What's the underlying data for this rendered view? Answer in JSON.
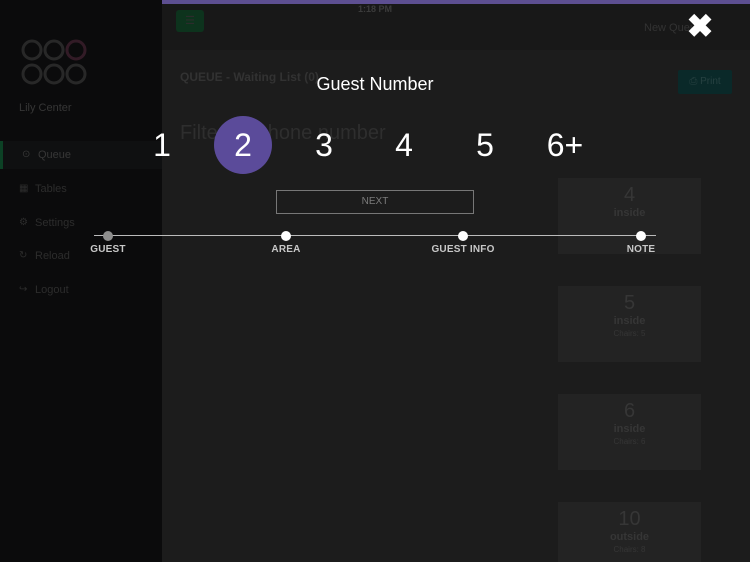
{
  "status_bar": {
    "time": "1:18 PM"
  },
  "header": {
    "menu_icon": "hamburger-icon",
    "user_label": "New Queue"
  },
  "sidebar": {
    "center_name": "Lily Center",
    "items": [
      {
        "label": "Queue",
        "icon": "clock-icon",
        "icon_glyph": "⊙",
        "active": true
      },
      {
        "label": "Tables",
        "icon": "table-icon",
        "icon_glyph": "▦",
        "active": false
      },
      {
        "label": "Settings",
        "icon": "gear-icon",
        "icon_glyph": "⚙",
        "active": false
      },
      {
        "label": "Reload",
        "icon": "reload-icon",
        "icon_glyph": "↻",
        "active": false
      },
      {
        "label": "Logout",
        "icon": "logout-icon",
        "icon_glyph": "↪",
        "active": false
      }
    ]
  },
  "main": {
    "queue_title": "QUEUE - Waiting List (0)",
    "print_label": "Print",
    "filter_placeholder": "Filter by phone number",
    "cards": [
      {
        "number": "4",
        "place": "inside",
        "meta": ""
      },
      {
        "number": "5",
        "place": "inside",
        "meta": "Chairs: 5"
      },
      {
        "number": "6",
        "place": "inside",
        "meta": "Chairs: 6"
      },
      {
        "number": "10",
        "place": "outside",
        "meta": "Chairs: 8"
      }
    ]
  },
  "modal": {
    "title": "Guest Number",
    "close_icon": "close-icon",
    "options": [
      "1",
      "2",
      "3",
      "4",
      "5",
      "6+"
    ],
    "selected_index": 1,
    "next_label": "NEXT",
    "steps": [
      {
        "label": "GUEST",
        "done": true
      },
      {
        "label": "AREA",
        "done": false
      },
      {
        "label": "GUEST INFO",
        "done": false
      },
      {
        "label": "NOTE",
        "done": false
      }
    ]
  },
  "colors": {
    "accent": "#5b4b9a",
    "active_green": "#0e4a2b",
    "print_teal": "#0c2f2f"
  }
}
